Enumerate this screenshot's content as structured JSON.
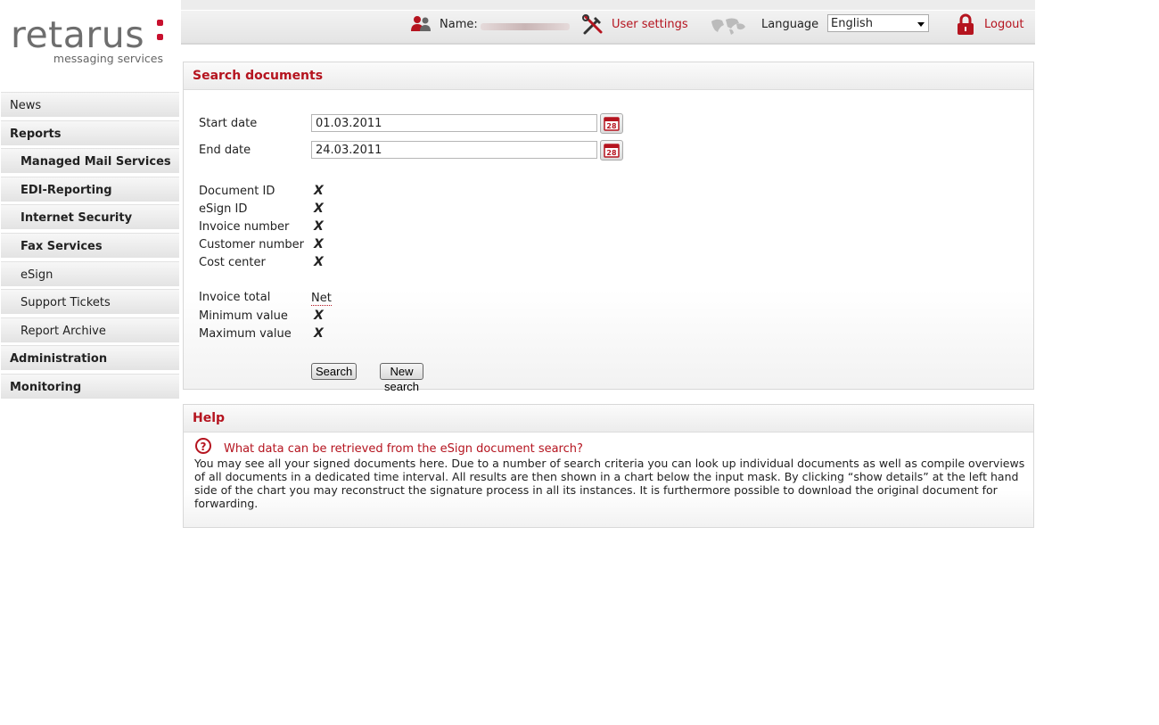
{
  "logo": {
    "word": "retarus",
    "tagline": "messaging services"
  },
  "topbar": {
    "name_label": "Name:",
    "user_settings": "User settings",
    "language_label": "Language",
    "language_value": "English",
    "logout": "Logout"
  },
  "sidebar": {
    "items": [
      {
        "label": "News"
      },
      {
        "label": "Reports"
      },
      {
        "label": "Managed Mail Services"
      },
      {
        "label": "EDI-Reporting"
      },
      {
        "label": "Internet Security"
      },
      {
        "label": "Fax Services"
      },
      {
        "label": "eSign"
      },
      {
        "label": "Support Tickets"
      },
      {
        "label": "Report Archive"
      },
      {
        "label": "Administration"
      },
      {
        "label": "Monitoring"
      }
    ]
  },
  "search": {
    "title": "Search documents",
    "start_label": "Start date",
    "start_value": "01.03.2011",
    "end_label": "End date",
    "end_value": "24.03.2011",
    "calendar_day": "28",
    "fields": [
      {
        "label": "Document ID",
        "value": "X"
      },
      {
        "label": "eSign ID",
        "value": "X"
      },
      {
        "label": "Invoice number",
        "value": "X"
      },
      {
        "label": "Customer number",
        "value": "X"
      },
      {
        "label": "Cost center",
        "value": "X"
      }
    ],
    "invoice_total_label": "Invoice total",
    "invoice_total_value": "Net",
    "min_label": "Minimum value",
    "min_value": "X",
    "max_label": "Maximum value",
    "max_value": "X",
    "search_button": "Search",
    "new_search_button": "New search"
  },
  "help": {
    "title": "Help",
    "question": "What data can be retrieved from the eSign document search?",
    "text": "You may see all your signed documents here. Due to a number of search criteria you can look up individual documents as well as compile overviews of all documents in a dedicated time interval. All results are then shown in a chart below the input mask. By clicking “show details” at the left hand side of the chart you may reconstruct the signature process in all its instances. It is furthermore possible to download the original document for forwarding."
  },
  "colors": {
    "accent": "#b5141f",
    "text": "#222222",
    "panel_border": "#d8d8d8"
  }
}
